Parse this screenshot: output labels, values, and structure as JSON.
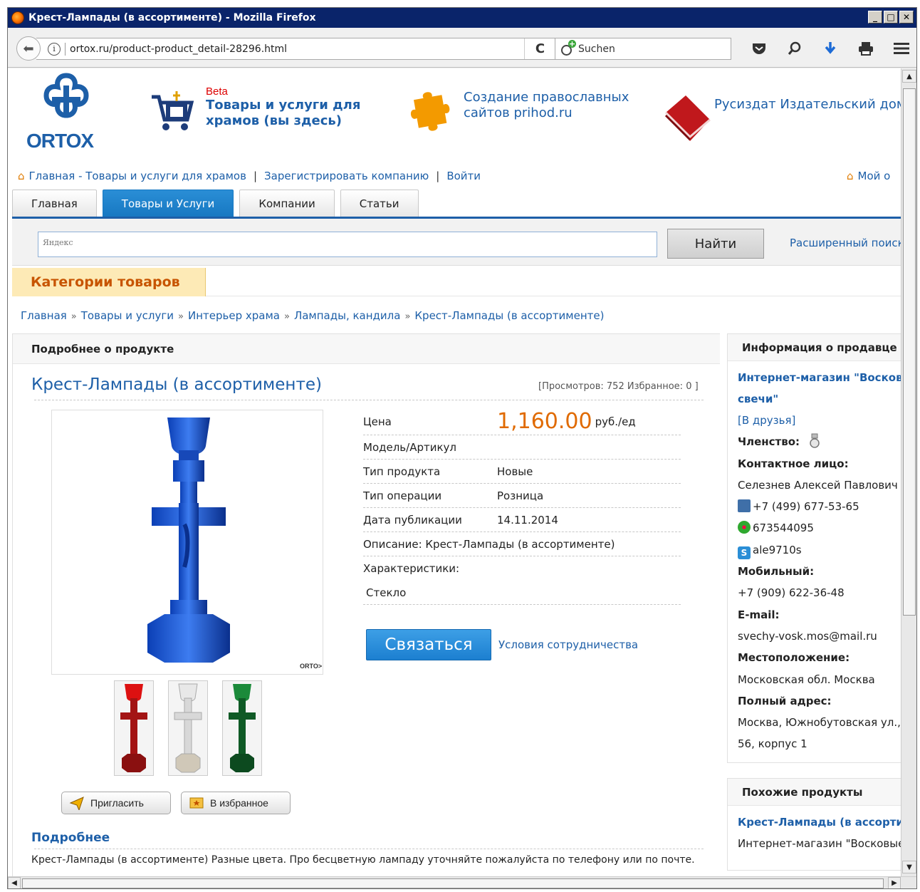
{
  "window": {
    "title": "Крест-Лампады (в ассортименте) - Mozilla Firefox"
  },
  "browser": {
    "url": "ortox.ru/product-product_detail-28296.html",
    "search_placeholder": "Suchen"
  },
  "header": {
    "logo_text": "ORTOX",
    "beta": "Beta",
    "promo1": "Товары и услуги для храмов (вы здесь)",
    "promo2": "Создание православных сайтов prihod.ru",
    "promo3": "Русиздат Издательский дом"
  },
  "topnav": {
    "home": "Главная - Товары и услуги для храмов",
    "register": "Зарегистрировать компанию",
    "login": "Войти",
    "my": "Мой о"
  },
  "tabs": [
    {
      "label": "Главная"
    },
    {
      "label": "Товары и Услуги"
    },
    {
      "label": "Компании"
    },
    {
      "label": "Статьи"
    }
  ],
  "search": {
    "placeholder": "Яндекс",
    "button": "Найти",
    "advanced": "Расширенный поиск"
  },
  "categories_label": "Категории товаров",
  "breadcrumb": [
    "Главная",
    "Товары и услуги",
    "Интерьер храма",
    "Лампады, кандила",
    "Крест-Лампады (в ассортименте)"
  ],
  "product": {
    "panel_title": "Подробнее о продукте",
    "title": "Крест-Лампады (в ассортименте)",
    "views": "[Просмотров: 752 Избранное: 0 ]",
    "price_label": "Цена",
    "price": "1,160.00",
    "price_unit": "руб./ед",
    "model_label": "Модель/Артикул",
    "type_label": "Тип продукта",
    "type_value": "Новые",
    "op_label": "Тип операции",
    "op_value": "Розница",
    "date_label": "Дата публикации",
    "date_value": "14.11.2014",
    "description": "Описание: Крест-Лампады (в ассортименте)",
    "char_label": "Характеристики:",
    "char_value": "Стекло",
    "contact_button": "Связаться",
    "terms_link": "Условия сотрудничества",
    "image_watermark": "ORTO>",
    "invite_button": "Пригласить",
    "fav_button": "В избранное",
    "detail_heading": "Подробнее",
    "detail_text": "Крест-Лампады (в ассортименте) Разные цвета. Про бесцветную лампаду уточняйте пожалуйста по телефону или по почте."
  },
  "seller": {
    "heading": "Информация о продавце",
    "shop_line1": "Интернет-магазин \"Восковые",
    "shop_line2": "свечи\"",
    "friends": "[В друзья]",
    "membership_label": "Членство:",
    "contact_label": "Контактное лицо:",
    "contact_name": "Селезнев Алексей Павлович",
    "phone": "+7 (499) 677-53-65",
    "icq": "673544095",
    "skype": "ale9710s",
    "mobile_label": "Мобильный:",
    "mobile": "+7 (909) 622-36-48",
    "email_label": "E-mail:",
    "email": "svechy-vosk.mos@mail.ru",
    "location_label": "Местоположение:",
    "location": "Московская обл. Москва",
    "address_label": "Полный адрес:",
    "address_line1": "Москва, Южнобутовская ул., д",
    "address_line2": "56, корпус 1"
  },
  "similar": {
    "heading": "Похожие продукты",
    "item_title": "Крест-Лампады (в ассортиме",
    "item_shop": "Интернет-магазин \"Восковые"
  }
}
